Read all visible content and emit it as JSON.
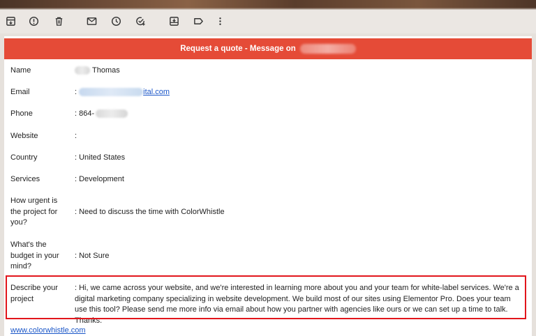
{
  "toolbar": {
    "icons": [
      "archive-icon",
      "report-spam-icon",
      "delete-icon",
      "mark-unread-icon",
      "snooze-icon",
      "add-task-icon",
      "move-to-icon",
      "label-icon",
      "more-options-icon"
    ]
  },
  "message": {
    "banner_title": "Request a quote - Message on",
    "rows": [
      {
        "label": "Name",
        "value": "Thomas"
      },
      {
        "label": "Email",
        "value_prefix": ": ",
        "value": "ital.com"
      },
      {
        "label": "Phone",
        "value": ": 864-"
      },
      {
        "label": "Website",
        "value": ":"
      },
      {
        "label": "Country",
        "value": ": United States"
      },
      {
        "label": "Services",
        "value": ": Development"
      },
      {
        "label": "How urgent is the project for you?",
        "value": ": Need to discuss the time with ColorWhistle"
      },
      {
        "label": "What's the budget in your mind?",
        "value": ": Not Sure"
      },
      {
        "label": "Describe your project",
        "value": ": Hi, we came across your website, and we're interested in learning more about you and your team for white-label services. We're a digital marketing company specializing in website development. We build most of our sites using Elementor Pro. Does your team use this tool? Please send me more info via email about how you partner with agencies like ours or we can set up a time to talk. Thanks."
      }
    ],
    "footer_link": "www.colorwhistle.com"
  },
  "colors": {
    "banner": "#e54b37",
    "highlight_border": "#e2151b",
    "link": "#1a56c8"
  }
}
